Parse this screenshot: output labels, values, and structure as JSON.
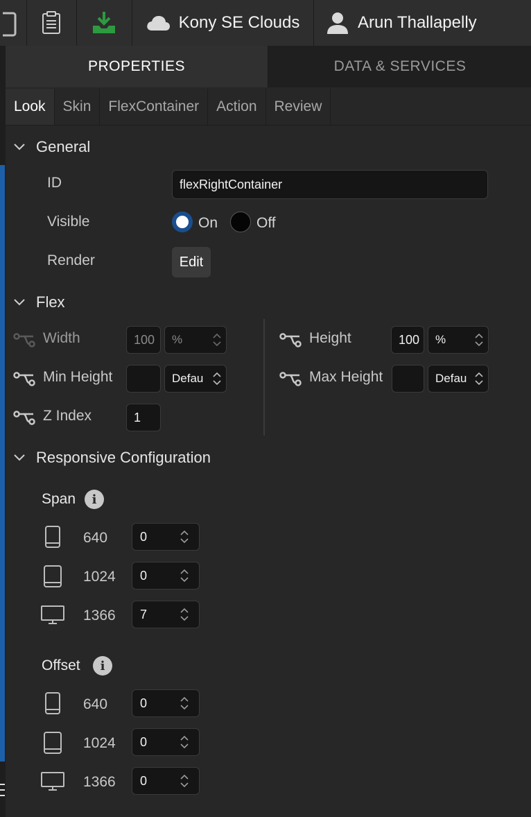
{
  "topbar": {
    "cloud_label": "Kony SE Clouds",
    "user_name": "Arun Thallapelly"
  },
  "tabs": {
    "properties": "PROPERTIES",
    "data_services": "DATA & SERVICES"
  },
  "subtabs": [
    "Look",
    "Skin",
    "FlexContainer",
    "Action",
    "Review"
  ],
  "general": {
    "title": "General",
    "id_label": "ID",
    "id_value": "flexRightContainer",
    "visible_label": "Visible",
    "visible_on": "On",
    "visible_off": "Off",
    "render_label": "Render",
    "render_button": "Edit"
  },
  "flex": {
    "title": "Flex",
    "width_label": "Width",
    "width_value": "100",
    "width_unit": "%",
    "height_label": "Height",
    "height_value": "100",
    "height_unit": "%",
    "min_height_label": "Min Height",
    "min_height_value": "",
    "min_height_unit": "Defau",
    "max_height_label": "Max Height",
    "max_height_value": "",
    "max_height_unit": "Defau",
    "zindex_label": "Z Index",
    "zindex_value": "1"
  },
  "responsive": {
    "title": "Responsive Configuration",
    "span_label": "Span",
    "span": [
      {
        "breakpoint": "640",
        "value": "0",
        "icon": "phone-icon"
      },
      {
        "breakpoint": "1024",
        "value": "0",
        "icon": "tablet-icon"
      },
      {
        "breakpoint": "1366",
        "value": "7",
        "icon": "desktop-icon"
      }
    ],
    "offset_label": "Offset",
    "offset": [
      {
        "breakpoint": "640",
        "value": "0",
        "icon": "phone-icon"
      },
      {
        "breakpoint": "1024",
        "value": "0",
        "icon": "tablet-icon"
      },
      {
        "breakpoint": "1366",
        "value": "0",
        "icon": "desktop-icon"
      }
    ]
  },
  "colors": {
    "accent": "#1a4f8e",
    "download_green": "#2e9a3f",
    "background": "#272727"
  }
}
